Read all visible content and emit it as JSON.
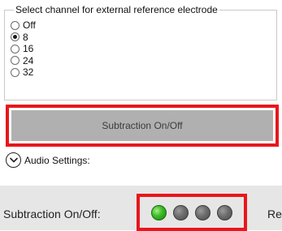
{
  "reference": {
    "title": "Select channel for external reference electrode",
    "options": [
      {
        "label": "Off",
        "checked": false
      },
      {
        "label": "8",
        "checked": true
      },
      {
        "label": "16",
        "checked": false
      },
      {
        "label": "24",
        "checked": false
      },
      {
        "label": "32",
        "checked": false
      }
    ]
  },
  "subtraction_button": {
    "label": "Subtraction On/Off"
  },
  "audio": {
    "label": "Audio Settings:",
    "icon": "chevron-down-icon"
  },
  "status": {
    "label": "Subtraction On/Off:",
    "leds": [
      {
        "state": "on",
        "color": "#3fbf2a"
      },
      {
        "state": "off",
        "color": "#6d6d6d"
      },
      {
        "state": "off",
        "color": "#6d6d6d"
      },
      {
        "state": "off",
        "color": "#6d6d6d"
      }
    ],
    "truncated_text": "Re"
  },
  "colors": {
    "highlight": "#e8161c",
    "button_bg": "#b0b0b0",
    "led_on": "#3fbf2a",
    "led_off": "#6d6d6d"
  }
}
